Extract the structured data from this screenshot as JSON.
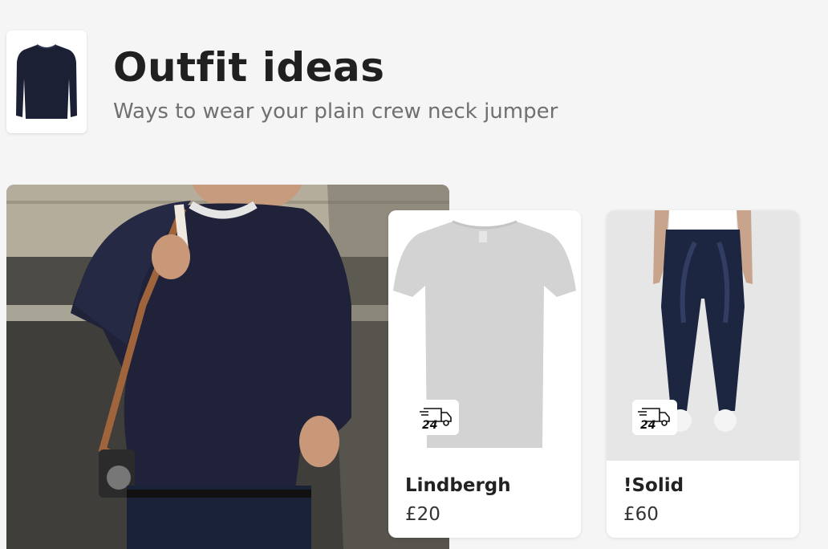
{
  "header": {
    "title": "Outfit ideas",
    "subtitle": "Ways to wear your plain crew neck jumper"
  },
  "products": [
    {
      "brand": "Lindbergh",
      "price": "£20",
      "badge": "24"
    },
    {
      "brand": "!Solid",
      "price": "£60",
      "badge": "24"
    }
  ],
  "icons": {
    "delivery": "delivery-truck-24-icon"
  },
  "colors": {
    "background": "#f5f5f5",
    "jumper": "#1c2035",
    "tshirt": "#d2d2d2",
    "jeans": "#1d2640"
  }
}
